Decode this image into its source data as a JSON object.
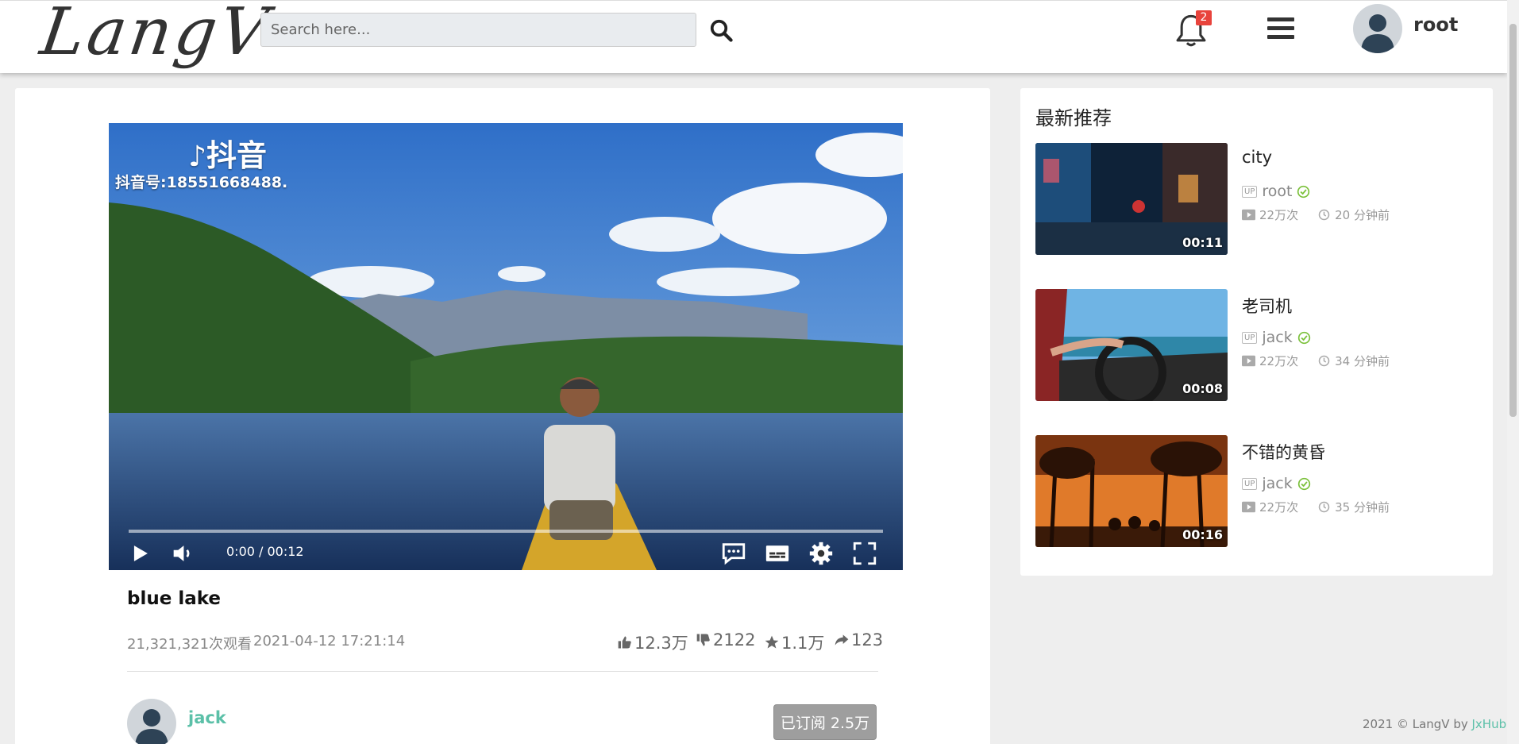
{
  "header": {
    "logo_text": "LangV",
    "search_placeholder": "Search here...",
    "notification_count": "2",
    "username": "root"
  },
  "player": {
    "watermark_brand": "抖音",
    "watermark_id": "抖音号:18551668488.",
    "time": "0:00 / 00:12",
    "progress_fraction": 0.0
  },
  "video": {
    "title": "blue lake",
    "views": "21,321,321次观看",
    "date": "2021-04-12 17:21:14",
    "likes": "12.3万",
    "dislikes": "2122",
    "favorites": "1.1万",
    "shares": "123"
  },
  "author": {
    "name": "jack",
    "subscribe_label": "已订阅 2.5万"
  },
  "sidebar": {
    "title": "最新推荐",
    "items": [
      {
        "title": "city",
        "up_tag": "UP",
        "author": "root",
        "views": "22万次",
        "time_ago": "20 分钟前",
        "duration": "00:11"
      },
      {
        "title": "老司机",
        "up_tag": "UP",
        "author": "jack",
        "views": "22万次",
        "time_ago": "34 分钟前",
        "duration": "00:08"
      },
      {
        "title": "不错的黄昏",
        "up_tag": "UP",
        "author": "jack",
        "views": "22万次",
        "time_ago": "35 分钟前",
        "duration": "00:16"
      }
    ]
  },
  "footer": {
    "text": "2021 © LangV by ",
    "link": "JxHub"
  },
  "colors": {
    "accent": "#5bc0a8",
    "badge": "#e8433c",
    "verified": "#7cc13c"
  }
}
